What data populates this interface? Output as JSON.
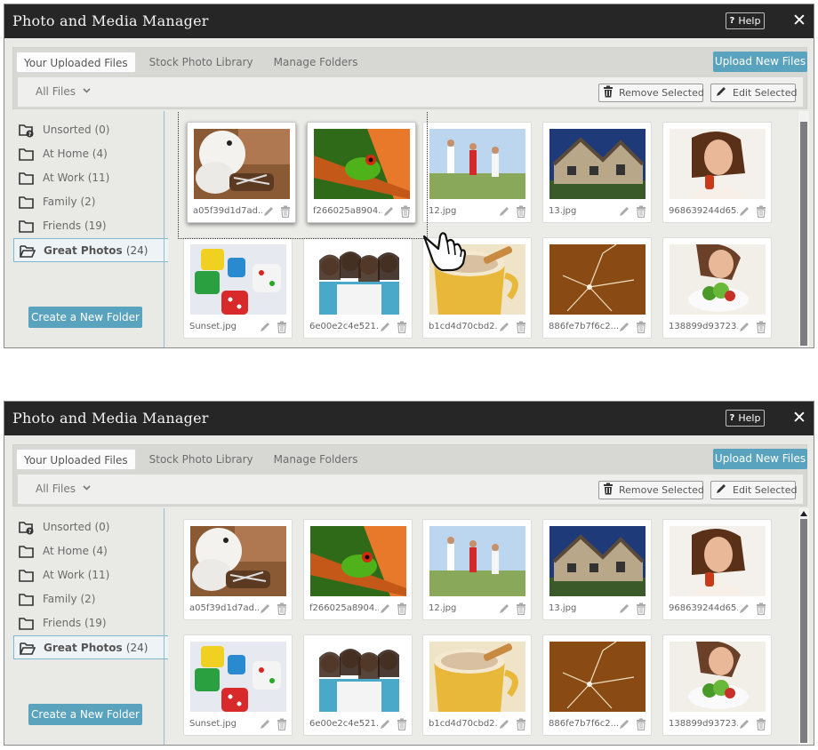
{
  "app": {
    "title": "Photo and Media Manager",
    "help_label": "Help",
    "help_icon_glyph": "?",
    "close_glyph": "✕"
  },
  "tabs": [
    {
      "label": "Your Uploaded Files",
      "active": true
    },
    {
      "label": "Stock Photo Library",
      "active": false
    },
    {
      "label": "Manage Folders",
      "active": false
    }
  ],
  "toolbar": {
    "upload_label": "Upload New Files",
    "filter_value": "All Files",
    "filter_chevron": "❯",
    "remove_label": "Remove Selected",
    "edit_label": "Edit Selected"
  },
  "folders": [
    {
      "name": "Unsorted",
      "count": "(0)",
      "icon": "unsorted-folder-icon"
    },
    {
      "name": "At Home",
      "count": "(4)",
      "icon": "folder-icon"
    },
    {
      "name": "At Work",
      "count": "(11)",
      "icon": "folder-icon"
    },
    {
      "name": "Family",
      "count": "(2)",
      "icon": "folder-icon"
    },
    {
      "name": "Friends",
      "count": "(19)",
      "icon": "folder-icon"
    },
    {
      "name": "Great Photos",
      "count": "(24)",
      "icon": "open-folder-icon",
      "active": true
    }
  ],
  "create_folder_label": "Create a New Folder",
  "photos": [
    {
      "filename": "a05f39d1d7ad...",
      "subject": "puppy"
    },
    {
      "filename": "f266025a8904...",
      "subject": "frog"
    },
    {
      "filename": "12.jpg",
      "subject": "walkers"
    },
    {
      "filename": "13.jpg",
      "subject": "house"
    },
    {
      "filename": "968639244d65...",
      "subject": "woman"
    },
    {
      "filename": "Sunset.jpg",
      "subject": "dice"
    },
    {
      "filename": "6e00e2c4e521...",
      "subject": "friends"
    },
    {
      "filename": "b1cd4d70cbd2...",
      "subject": "coffee"
    },
    {
      "filename": "886fe7b7f6c2...",
      "subject": "crack"
    },
    {
      "filename": "138899d93723...",
      "subject": "salad"
    }
  ],
  "panels": [
    {
      "state": "dragging-selection",
      "selected": [
        "a05f39d1d7ad...",
        "f266025a8904..."
      ]
    },
    {
      "state": "after-drop",
      "selected": []
    }
  ],
  "colors": {
    "titlebar": "#262626",
    "accent": "#5aa3be",
    "panel_bg": "#e9e9e6"
  }
}
